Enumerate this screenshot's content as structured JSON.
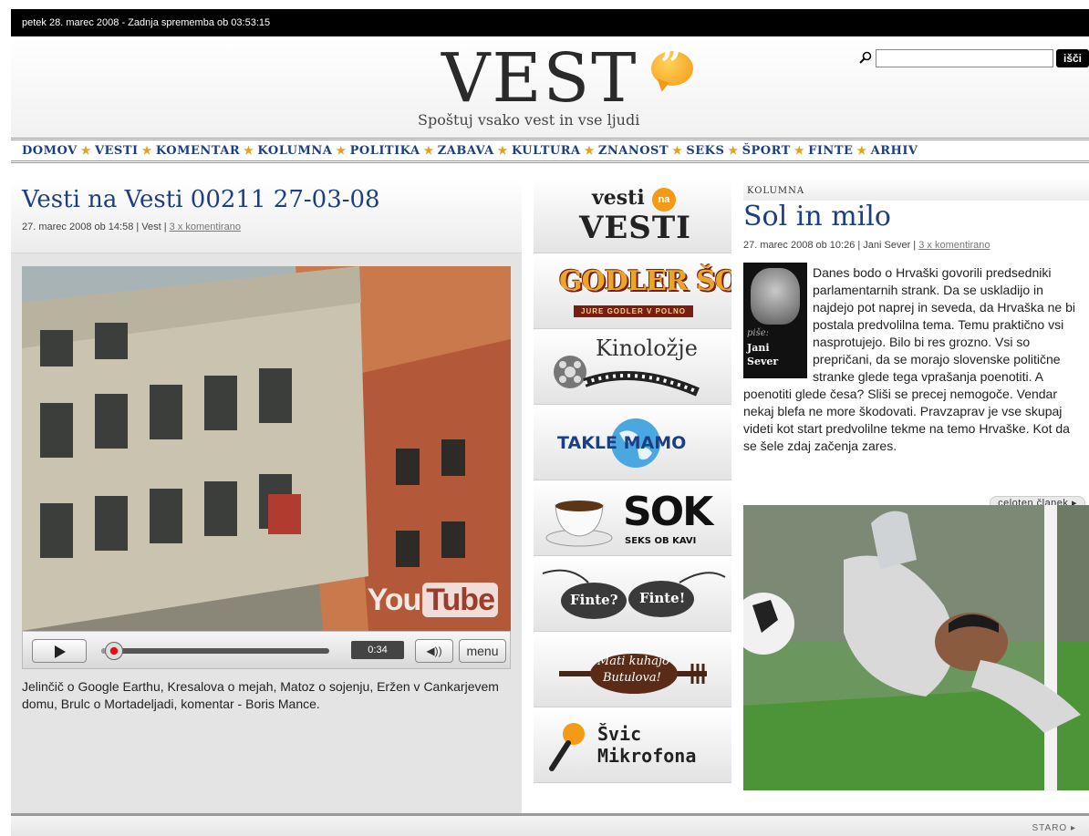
{
  "topbar": {
    "date": "petek 28. marec 2008 - Zadnja sprememba ob 03:53:15"
  },
  "header": {
    "logo_text": "VEST",
    "tagline": "Spoštuj vsako vest in vse ljudi",
    "search_button": "išči"
  },
  "nav": {
    "items": [
      "DOMOV",
      "VESTI",
      "KOMENTAR",
      "KOLUMNA",
      "POLITIKA",
      "ZABAVA",
      "KULTURA",
      "ZNANOST",
      "SEKS",
      "ŠPORT",
      "FINTE",
      "ARHIV"
    ],
    "separator": "★"
  },
  "video_article": {
    "title": "Vesti na Vesti 00211 27-03-08",
    "meta": "27. marec 2008 ob 14:58 | Vest |",
    "comments": "3 x komentirano",
    "player": {
      "time": "0:34",
      "menu": "menu",
      "progress": 0.07,
      "watermark_1": "You",
      "watermark_2": "Tube"
    },
    "description": "Jelinčič o Google Earthu, Kresalova o mejah, Matoz o sojenju, Eržen v Cankarjevem domu, Brulc o Mortadeljadi, komentar - Boris Mance."
  },
  "banners": {
    "vesti_na_vesti": {
      "top": "vesti",
      "badge": "na",
      "bottom": "VESTI"
    },
    "godler_sov": {
      "title": "GODLER ŠOV",
      "subtitle": "JURE GODLER V POLNO"
    },
    "kinolozje": {
      "title": "Kinoložje"
    },
    "takle_mamo": {
      "title": "TAKLE MAMO"
    },
    "sok": {
      "title": "SOK",
      "subtitle": "SEKS OB KAVI"
    },
    "finte": {
      "left": "Finte?",
      "right": "Finte!"
    },
    "mati_kuhajo": {
      "line1": "Mati kuhajo",
      "line2": "Butulova!"
    },
    "svic_mikrofona": {
      "line1": "Švic",
      "line2": "Mikrofona"
    }
  },
  "column_article": {
    "section": "KOLUMNA",
    "title": "Sol in milo",
    "meta": "27. marec 2008 ob 10:26 | Jani Sever |",
    "comments": "3 x komentirano",
    "author_label": "piše:",
    "author_name": "Jani Sever",
    "body": "Danes bodo o Hrvaški govorili predsedniki parlamentarnih strank. Da se uskladijo in najdejo pot naprej in seveda, da Hrvaška ne bi postala predvolilna tema. Temu praktično vsi nasprotujejo. Bilo bi res grozno. Vsi so prepričani, da se morajo slovenske politične stranke glede tega vprašanja poenotiti. A poenotiti glede česa? Sliši se precej nemogoče. Vendar nekaj blefa ne more škodovati. Pravzaprav je vse skupaj videti kot start predvolilne tekme na temo Hrvaške. Kot da se šele zdaj začenja zares.",
    "more": "celoten članek ▸"
  },
  "footer": {
    "older": "STARO ▸"
  },
  "colors": {
    "nav_blue": "#1c3f83",
    "star_gold": "#e0a321",
    "logo_orange": "#f39a16"
  }
}
